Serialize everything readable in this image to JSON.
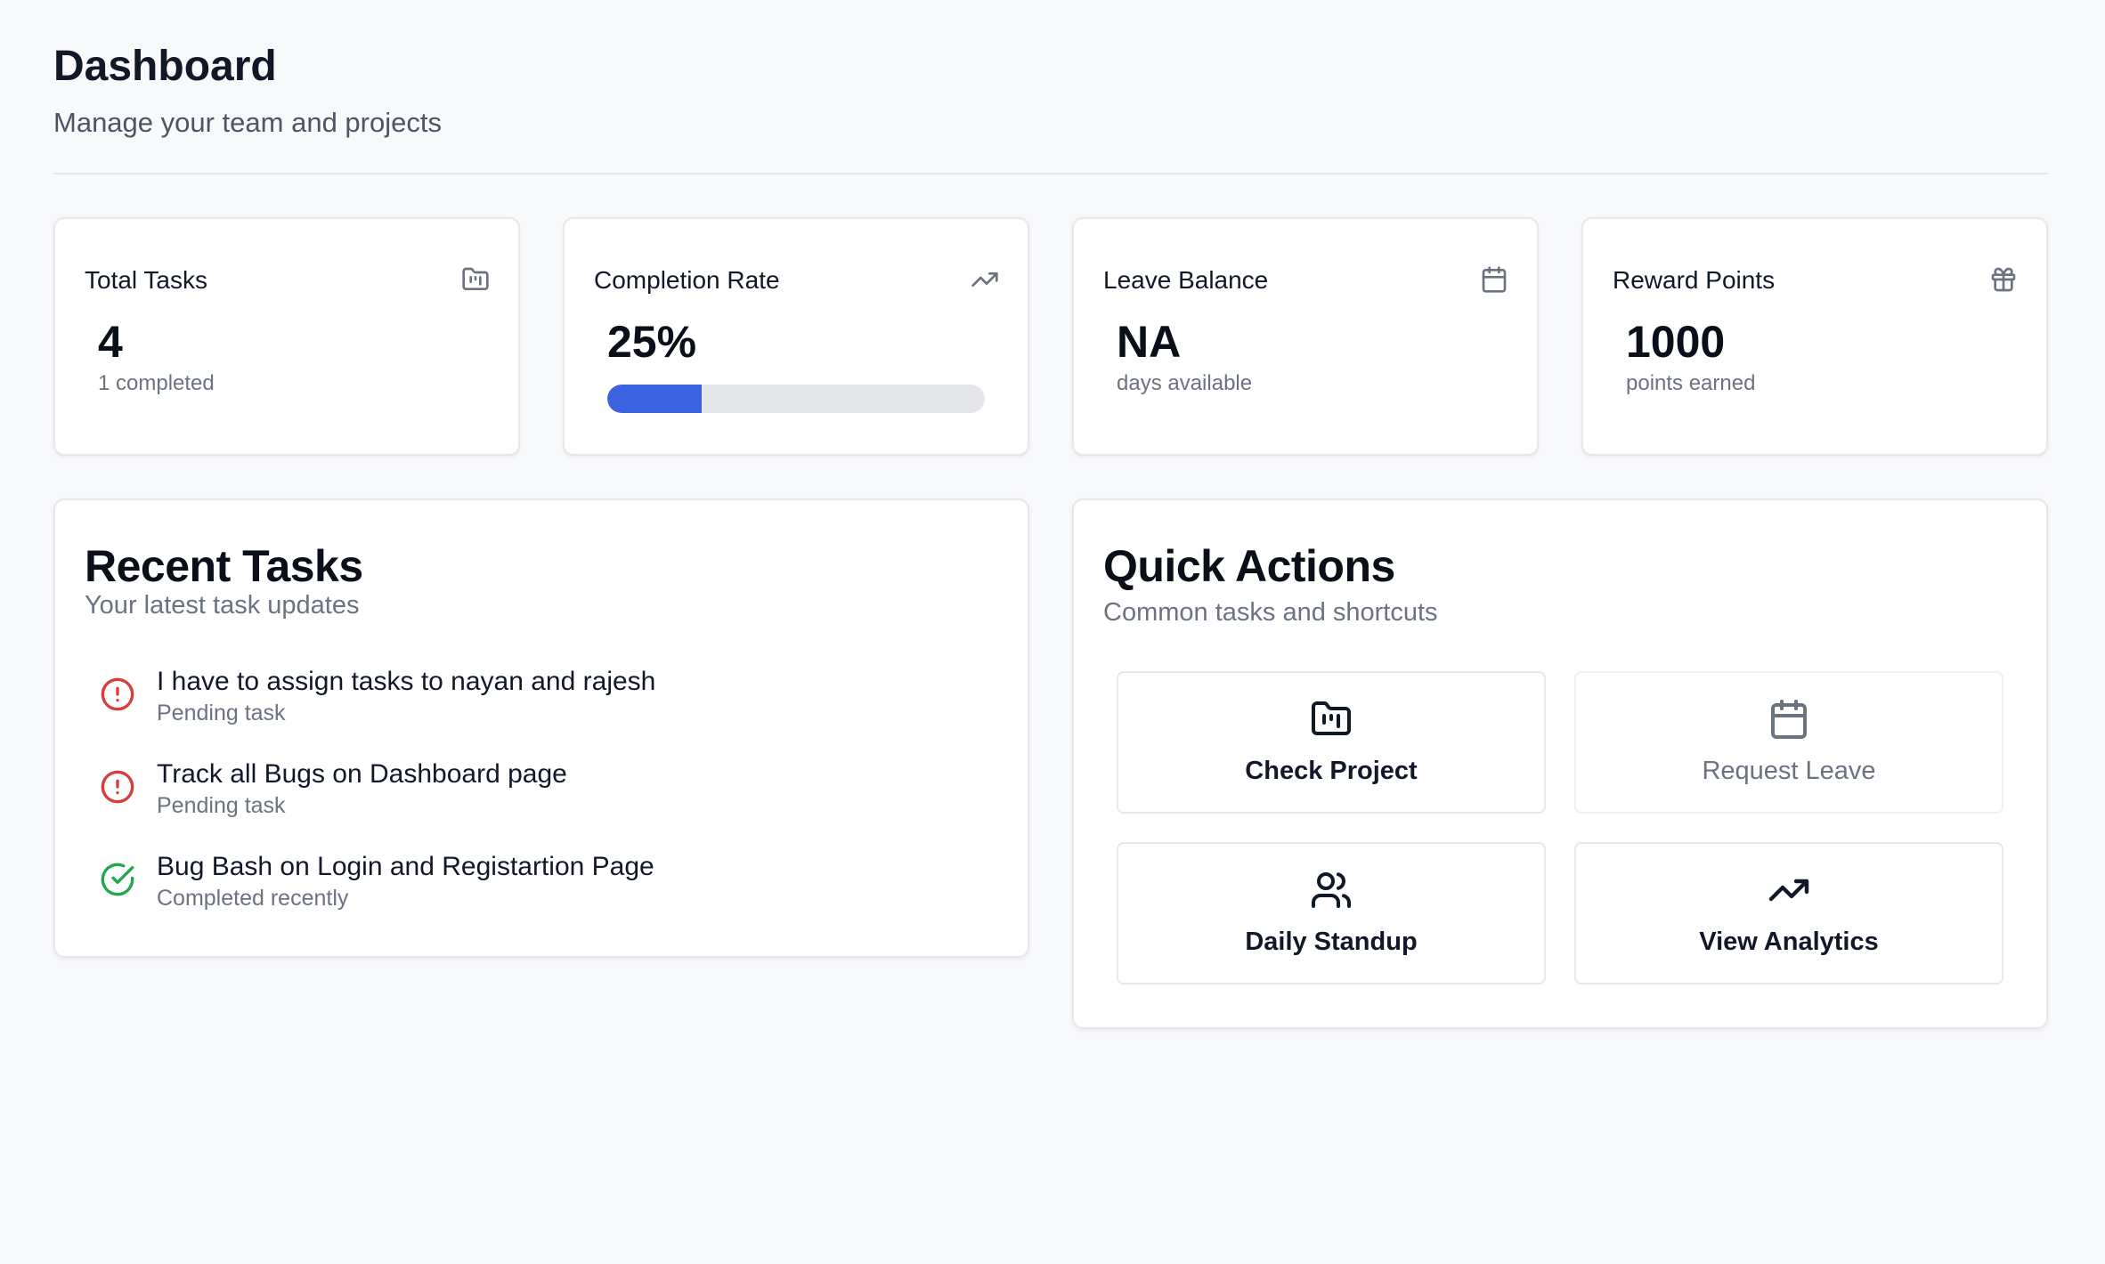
{
  "header": {
    "title": "Dashboard",
    "subtitle": "Manage your team and projects"
  },
  "stats": [
    {
      "title": "Total Tasks",
      "value": "4",
      "sub": "1 completed",
      "icon": "folder-kanban-icon"
    },
    {
      "title": "Completion Rate",
      "value": "25%",
      "progress": 0.25,
      "icon": "trending-up-icon"
    },
    {
      "title": "Leave Balance",
      "value": "NA",
      "sub": "days available",
      "icon": "calendar-icon"
    },
    {
      "title": "Reward Points",
      "value": "1000",
      "sub": "points earned",
      "icon": "gift-icon"
    }
  ],
  "recent_tasks": {
    "title": "Recent Tasks",
    "subtitle": "Your latest task updates",
    "items": [
      {
        "name": "I have to assign tasks to nayan and rajesh",
        "status": "Pending task",
        "state": "pending",
        "icon": "alert-circle-icon"
      },
      {
        "name": "Track all Bugs on Dashboard page",
        "status": "Pending task",
        "state": "pending",
        "icon": "alert-circle-icon"
      },
      {
        "name": "Bug Bash on Login and Registartion Page",
        "status": "Completed recently",
        "state": "completed",
        "icon": "check-circle-icon"
      }
    ]
  },
  "quick_actions": {
    "title": "Quick Actions",
    "subtitle": "Common tasks and shortcuts",
    "items": [
      {
        "label": "Check Project",
        "icon": "folder-kanban-icon",
        "enabled": true
      },
      {
        "label": "Request Leave",
        "icon": "calendar-icon",
        "enabled": false
      },
      {
        "label": "Daily Standup",
        "icon": "users-icon",
        "enabled": true
      },
      {
        "label": "View Analytics",
        "icon": "trending-up-icon",
        "enabled": true
      }
    ]
  },
  "colors": {
    "accent": "#3b63df",
    "pending": "#dc3b3b",
    "completed": "#22a74a",
    "background": "#f8f9fb"
  }
}
